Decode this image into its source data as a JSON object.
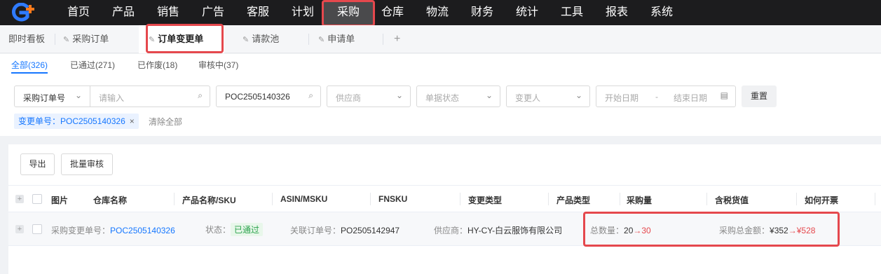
{
  "nav": {
    "items": [
      "首页",
      "产品",
      "销售",
      "广告",
      "客服",
      "计划",
      "采购",
      "仓库",
      "物流",
      "财务",
      "统计",
      "工具",
      "报表",
      "系统"
    ],
    "active": "采购"
  },
  "tabs": [
    {
      "label": "即时看板"
    },
    {
      "label": "采购订单"
    },
    {
      "label": "订单变更单"
    },
    {
      "label": "请款池"
    },
    {
      "label": "申请单"
    }
  ],
  "tab_add": "+",
  "status_tabs": [
    "全部(326)",
    "已通过(271)",
    "已作废(18)",
    "审核中(37)"
  ],
  "filters": {
    "search_type": "采购订单号",
    "search_placeholder": "请输入",
    "change_no": "POC2505140326",
    "supplier_placeholder": "供应商",
    "doc_status_placeholder": "单据状态",
    "changer_placeholder": "变更人",
    "start_date_placeholder": "开始日期",
    "date_sep": "-",
    "end_date_placeholder": "结束日期",
    "reset": "重置"
  },
  "active_tag": "变更单号：POC2505140326",
  "clear_all": "清除全部",
  "actions": {
    "export": "导出",
    "batch_review": "批量审核"
  },
  "columns": [
    "图片",
    "仓库名称",
    "产品名称/SKU",
    "ASIN/MSKU",
    "FNSKU",
    "变更类型",
    "产品类型",
    "采购量",
    "含税货值",
    "如何开票"
  ],
  "row": {
    "change_label": "采购变更单号：",
    "change_no": "POC2505140326",
    "status_label": "状态：",
    "status": "已通过",
    "order_label": "关联订单号：",
    "order_no": "PO2505142947",
    "supplier_label": "供应商：",
    "supplier": "HY-CY-白云服饰有限公司",
    "qty_label": "总数量：",
    "qty_old": "20",
    "qty_arrow": "→",
    "qty_new": "30",
    "amount_label": "采购总金额：",
    "amount_old": "¥352",
    "amount_arrow": "→",
    "amount_new": "¥528"
  },
  "colors": {
    "highlight": "#e5484d",
    "link": "#1677ff",
    "nav_bg": "#1c1c1e"
  }
}
